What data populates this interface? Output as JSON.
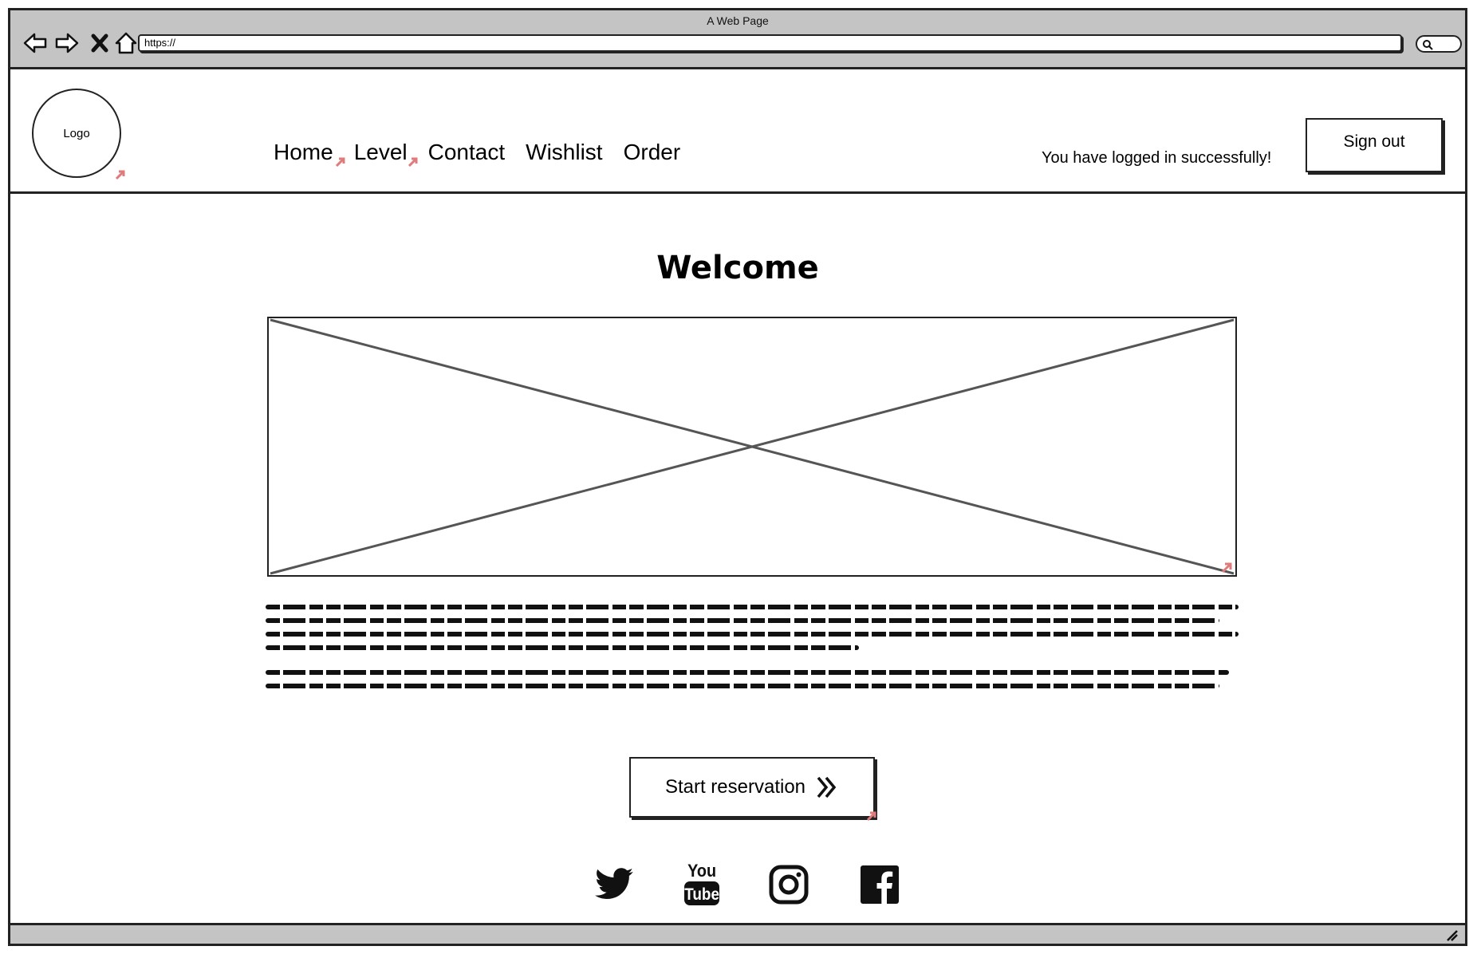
{
  "browser": {
    "title": "A Web Page",
    "url": "https://"
  },
  "header": {
    "logo_text": "Logo",
    "nav": [
      {
        "label": "Home"
      },
      {
        "label": "Level"
      },
      {
        "label": "Contact"
      },
      {
        "label": "Wishlist"
      },
      {
        "label": "Order"
      }
    ],
    "login_message": "You have logged in successfully!",
    "signout_label": "Sign out"
  },
  "main": {
    "heading": "Welcome",
    "cta_label": "Start reservation"
  },
  "social": {
    "icons": [
      "twitter-icon",
      "youtube-icon",
      "instagram-icon",
      "facebook-icon"
    ]
  },
  "colors": {
    "chrome": "#c4c4c4",
    "link_marker": "#e07b7b",
    "stroke": "#222222"
  }
}
